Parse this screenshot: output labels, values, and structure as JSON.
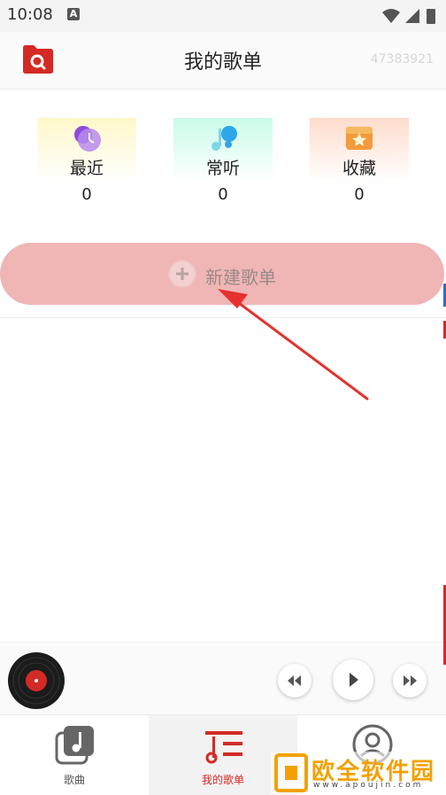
{
  "status_bar": {
    "time": "10:08",
    "notification_badge": "A"
  },
  "header": {
    "title": "我的歌单",
    "user_id": "47383921"
  },
  "categories": [
    {
      "label": "最近",
      "count": "0",
      "icon": "clock-icon"
    },
    {
      "label": "常听",
      "count": "0",
      "icon": "music-note-icon"
    },
    {
      "label": "收藏",
      "count": "0",
      "icon": "star-icon"
    }
  ],
  "new_playlist": {
    "label": "新建歌单"
  },
  "bottom_nav": [
    {
      "label": "歌曲",
      "icon": "music-note-icon"
    },
    {
      "label": "我的歌单",
      "icon": "playlist-icon",
      "active": true
    },
    {
      "label": "",
      "icon": "user-icon"
    }
  ],
  "watermark": {
    "text": "欧全软件园",
    "url": "www.apoujin.com"
  },
  "colors": {
    "accent": "#d42a25",
    "new_playlist_bg": "#f0b5b5",
    "watermark": "#f3a100"
  }
}
